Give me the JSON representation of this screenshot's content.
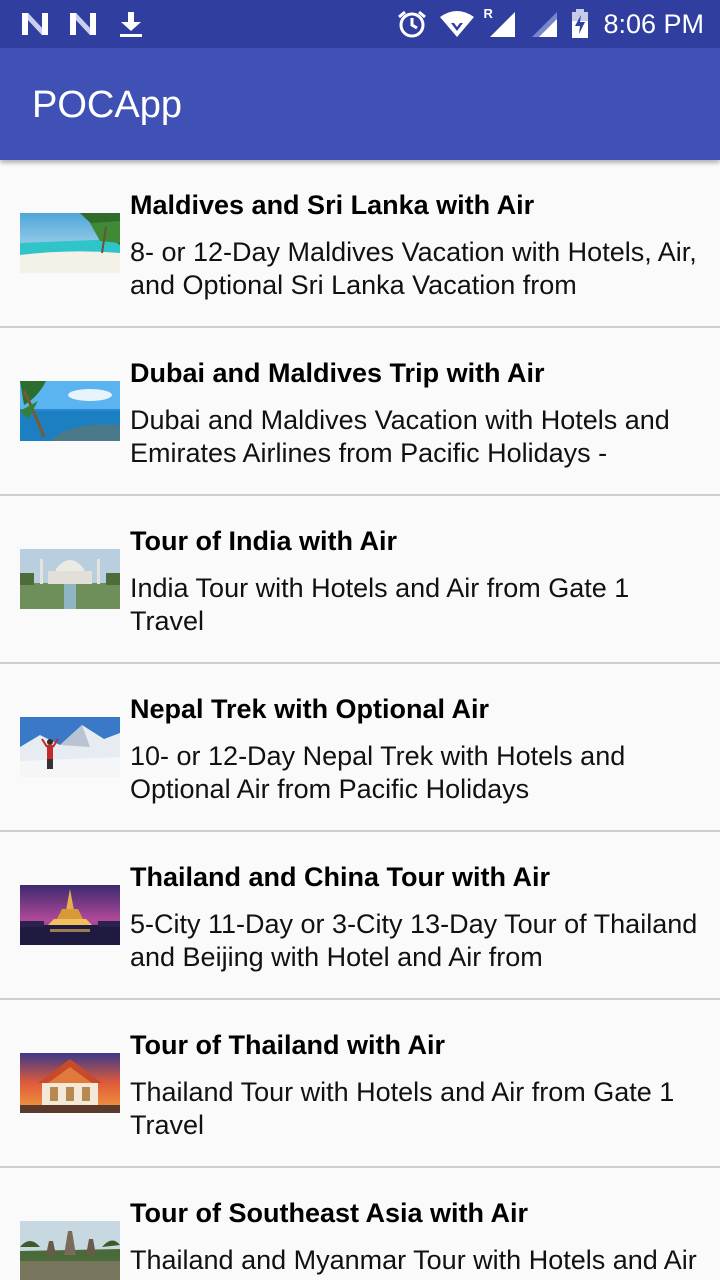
{
  "status_bar": {
    "time": "8:06 PM",
    "left_icons": [
      "n-notification-icon",
      "n-notification-icon",
      "download-icon"
    ],
    "right_icons": [
      "alarm-icon",
      "wifi-icon",
      "signal-roaming-icon",
      "signal-icon",
      "battery-charging-icon"
    ],
    "roaming_label": "R"
  },
  "app_bar": {
    "title": "POCApp",
    "color": "#3f51b5",
    "status_color": "#303f9f"
  },
  "deals": [
    {
      "title": "Maldives and Sri Lanka with Air",
      "description": "8- or 12-Day Maldives Vacation with Hotels, Air, and Optional Sri Lanka Vacation from",
      "thumbnail": "beach-palm-thumbnail"
    },
    {
      "title": "Dubai and Maldives Trip with Air",
      "description": "Dubai and Maldives Vacation with Hotels and Emirates Airlines from Pacific Holidays -",
      "thumbnail": "palm-ocean-thumbnail"
    },
    {
      "title": "Tour of India with Air",
      "description": "India Tour with Hotels and Air from Gate 1 Travel",
      "thumbnail": "taj-mahal-thumbnail"
    },
    {
      "title": "Nepal Trek with Optional Air",
      "description": "10- or 12-Day Nepal Trek with Hotels and Optional Air from Pacific Holidays",
      "thumbnail": "mountain-trekker-thumbnail"
    },
    {
      "title": "Thailand and China Tour with Air",
      "description": "5-City 11-Day or 3-City 13-Day Tour of Thailand and Beijing with Hotel and Air from",
      "thumbnail": "thai-temple-night-thumbnail"
    },
    {
      "title": "Tour of Thailand with Air",
      "description": "Thailand Tour with Hotels and Air from Gate 1 Travel",
      "thumbnail": "thai-temple-sunset-thumbnail"
    },
    {
      "title": "Tour of Southeast Asia with Air",
      "description": "Thailand and Myanmar Tour with Hotels and Air from",
      "thumbnail": "temple-ruins-thumbnail"
    }
  ]
}
